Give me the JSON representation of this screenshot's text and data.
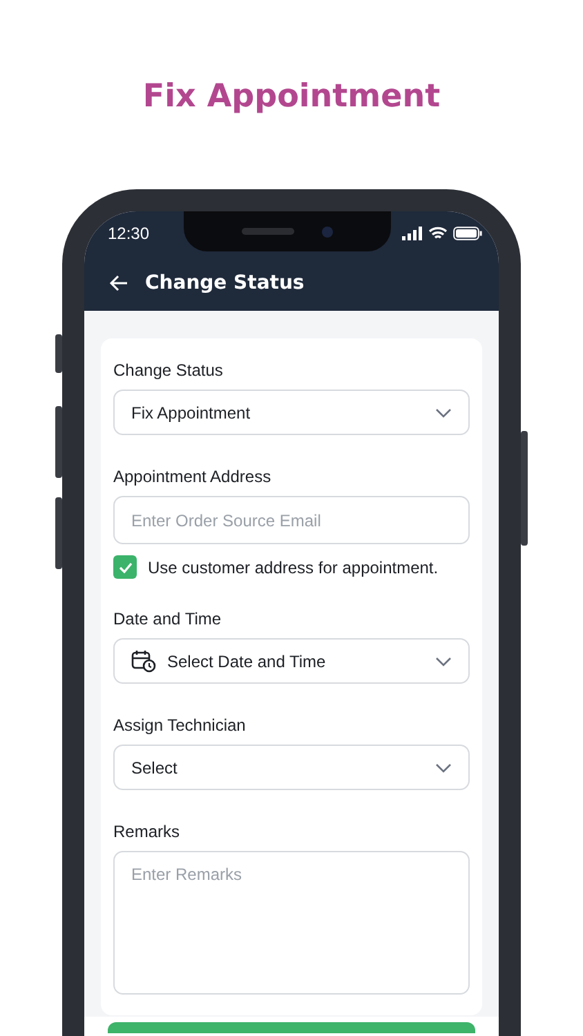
{
  "page_title": "Fix Appointment",
  "status_bar": {
    "time": "12:30"
  },
  "header": {
    "title": "Change Status"
  },
  "form": {
    "fields": [
      {
        "kind": "select",
        "label": "Change Status",
        "value": "Fix Appointment"
      },
      {
        "kind": "input",
        "label": "Appointment Address",
        "placeholder": "Enter Order Source Email"
      },
      {
        "kind": "checkbox",
        "label": "Use customer address for appointment.",
        "checked": true
      },
      {
        "kind": "datetime",
        "label": "Date and Time",
        "value": "Select Date and Time"
      },
      {
        "kind": "select",
        "label": "Assign Technician",
        "value": "Select"
      },
      {
        "kind": "textarea",
        "label": "Remarks",
        "placeholder": "Enter Remarks"
      }
    ]
  }
}
